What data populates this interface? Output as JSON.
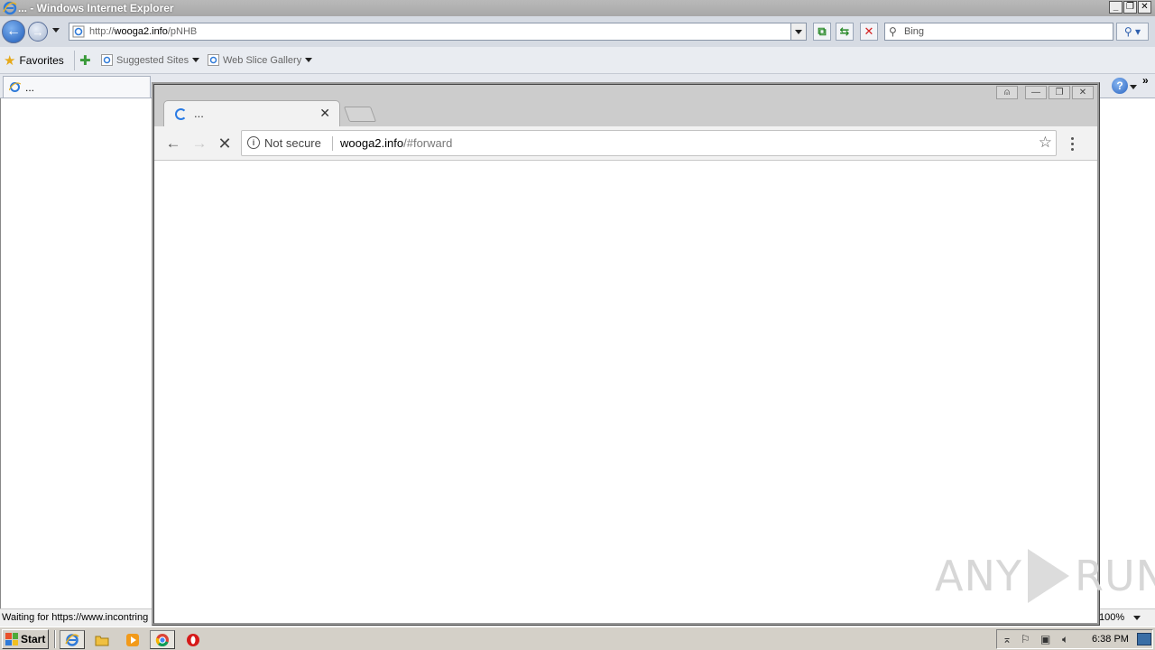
{
  "ie": {
    "title": "... - Windows Internet Explorer",
    "address_prefix": "http://",
    "address_host": "wooga2.info",
    "address_path": "/pNHB",
    "search_placeholder": "Bing",
    "favorites_label": "Favorites",
    "favbar": [
      {
        "label": "Suggested Sites"
      },
      {
        "label": "Web Slice Gallery"
      }
    ],
    "tab_title": "...",
    "status_text": "Waiting for https://www.incontring",
    "zoom_level": "100%"
  },
  "chrome": {
    "tab_title": "...",
    "security_label": "Not secure",
    "url_host": "wooga2.info",
    "url_path": "/#forward"
  },
  "taskbar": {
    "start_label": "Start",
    "clock": "6:38 PM"
  },
  "watermark": {
    "text_left": "ANY",
    "text_right": "RUN"
  },
  "colors": {
    "chrome_spinner": "#2a7be4",
    "ie_back": "#1e5bb8",
    "stop_red": "#d42020"
  }
}
